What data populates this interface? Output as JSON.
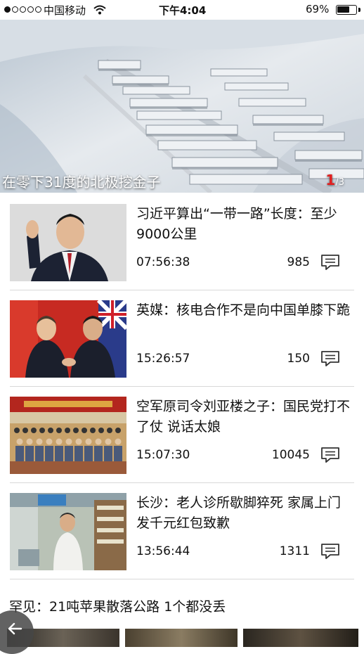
{
  "status_bar": {
    "carrier": "中国移动",
    "time": "下午4:04",
    "battery_percent": "69%",
    "battery_level": 0.69,
    "signal_bars_filled": 1,
    "signal_bars_total": 5
  },
  "hero": {
    "caption": "在零下31度的北极挖金子",
    "pager_current": "1",
    "pager_total": "/3"
  },
  "news": [
    {
      "title": "习近平算出“一带一路”长度：至少9000公里",
      "time": "07:56:38",
      "comments": "985",
      "thumb_icon": "leader-waving-photo"
    },
    {
      "title": "英媒：核电合作不是向中国单膝下跪",
      "time": "15:26:57",
      "comments": "150",
      "thumb_icon": "leaders-handshake-photo"
    },
    {
      "title": "空军原司令刘亚楼之子：国民党打不了仗 说话太娘",
      "time": "15:07:30",
      "comments": "10045",
      "thumb_icon": "group-photo"
    },
    {
      "title": "长沙：老人诊所歇脚猝死 家属上门发千元红包致歉",
      "time": "13:56:44",
      "comments": "1311",
      "thumb_icon": "clinic-photo"
    }
  ],
  "bottom_headline": "罕见：21吨苹果散落公路 1个都没丢",
  "icons": {
    "comment": "comment-icon",
    "back": "back-arrow-icon",
    "wifi": "wifi-icon"
  },
  "colors": {
    "pager_accent": "#e02020",
    "divider": "#d8d8d8"
  }
}
